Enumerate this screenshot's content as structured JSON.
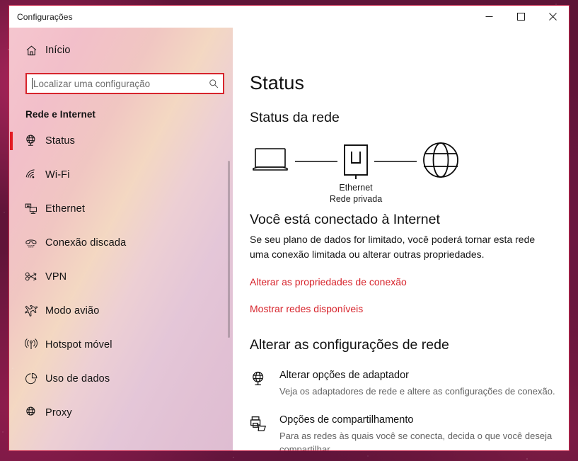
{
  "window": {
    "title": "Configurações",
    "minimize_label": "Minimizar",
    "maximize_label": "Maximizar",
    "close_label": "Fechar"
  },
  "sidebar": {
    "home": {
      "label": "Início",
      "icon": "home-icon"
    },
    "search": {
      "placeholder": "Localizar uma configuração",
      "value": "",
      "icon": "search-icon"
    },
    "group_header": "Rede e Internet",
    "items": [
      {
        "label": "Status",
        "icon": "globe-monitor-icon",
        "selected": true
      },
      {
        "label": "Wi-Fi",
        "icon": "wifi-icon",
        "selected": false
      },
      {
        "label": "Ethernet",
        "icon": "ethernet-icon",
        "selected": false
      },
      {
        "label": "Conexão discada",
        "icon": "dialup-phone-icon",
        "selected": false
      },
      {
        "label": "VPN",
        "icon": "vpn-key-icon",
        "selected": false
      },
      {
        "label": "Modo avião",
        "icon": "airplane-icon",
        "selected": false
      },
      {
        "label": "Hotspot móvel",
        "icon": "hotspot-icon",
        "selected": false
      },
      {
        "label": "Uso de dados",
        "icon": "pie-chart-icon",
        "selected": false
      },
      {
        "label": "Proxy",
        "icon": "globe-icon",
        "selected": false
      }
    ]
  },
  "main": {
    "page_title": "Status",
    "section_title": "Status da rede",
    "diagram": {
      "device_icon": "laptop-icon",
      "adapter_icon": "ethernet-port-icon",
      "internet_icon": "globe-icon",
      "adapter_name": "Ethernet",
      "adapter_profile": "Rede privada"
    },
    "connection_status": "Você está conectado à Internet",
    "connection_description": "Se seu plano de dados for limitado, você poderá tornar esta rede uma conexão limitada ou alterar outras propriedades.",
    "links": [
      "Alterar as propriedades de conexão",
      "Mostrar redes disponíveis"
    ],
    "change_settings_title": "Alterar as configurações de rede",
    "options": [
      {
        "icon": "globe-monitor-icon",
        "title": "Alterar opções de adaptador",
        "description": "Veja os adaptadores de rede e altere as configurações de conexão."
      },
      {
        "icon": "printer-folder-icon",
        "title": "Opções de compartilhamento",
        "description": "Para as redes às quais você se conecta, decida o que você deseja compartilhar."
      }
    ]
  },
  "colors": {
    "accent_red": "#d7242c",
    "selection_bar": "#e31b23",
    "window_border": "#c8264a",
    "muted_text": "#636363"
  }
}
